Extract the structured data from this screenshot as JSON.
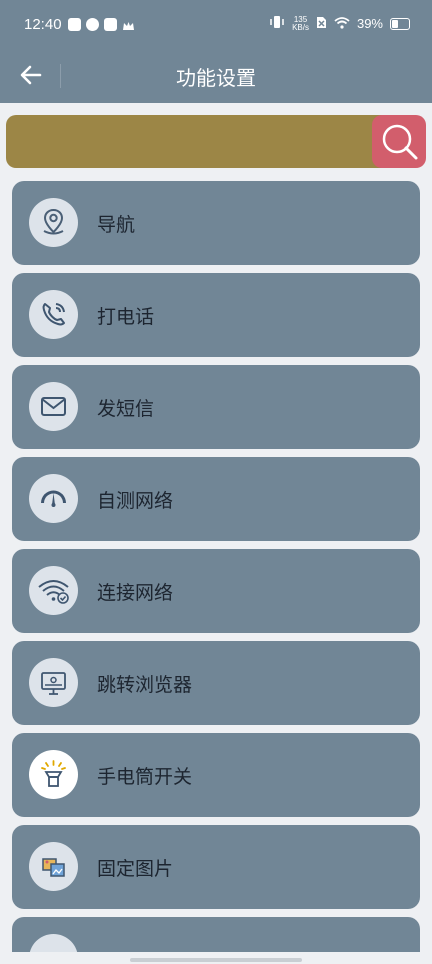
{
  "status_bar": {
    "time": "12:40",
    "net_speed_value": "135",
    "net_speed_unit": "KB/s",
    "battery": "39%"
  },
  "header": {
    "title": "功能设置"
  },
  "search": {
    "placeholder": "",
    "field_color": "#9c8646",
    "button_color": "#d25e6c"
  },
  "menu": {
    "items": [
      {
        "label": "导航",
        "icon": "location-pin-icon"
      },
      {
        "label": "打电话",
        "icon": "phone-icon"
      },
      {
        "label": "发短信",
        "icon": "envelope-icon"
      },
      {
        "label": "自测网络",
        "icon": "speedometer-icon"
      },
      {
        "label": "连接网络",
        "icon": "wifi-check-icon"
      },
      {
        "label": "跳转浏览器",
        "icon": "monitor-browser-icon"
      },
      {
        "label": "手电筒开关",
        "icon": "flashlight-icon"
      },
      {
        "label": "固定图片",
        "icon": "picture-pin-icon"
      },
      {
        "label": "",
        "icon": "settings-item-icon"
      }
    ]
  },
  "colors": {
    "header_bg": "#718696",
    "card_bg": "#718696",
    "page_bg": "#eef0f3"
  }
}
